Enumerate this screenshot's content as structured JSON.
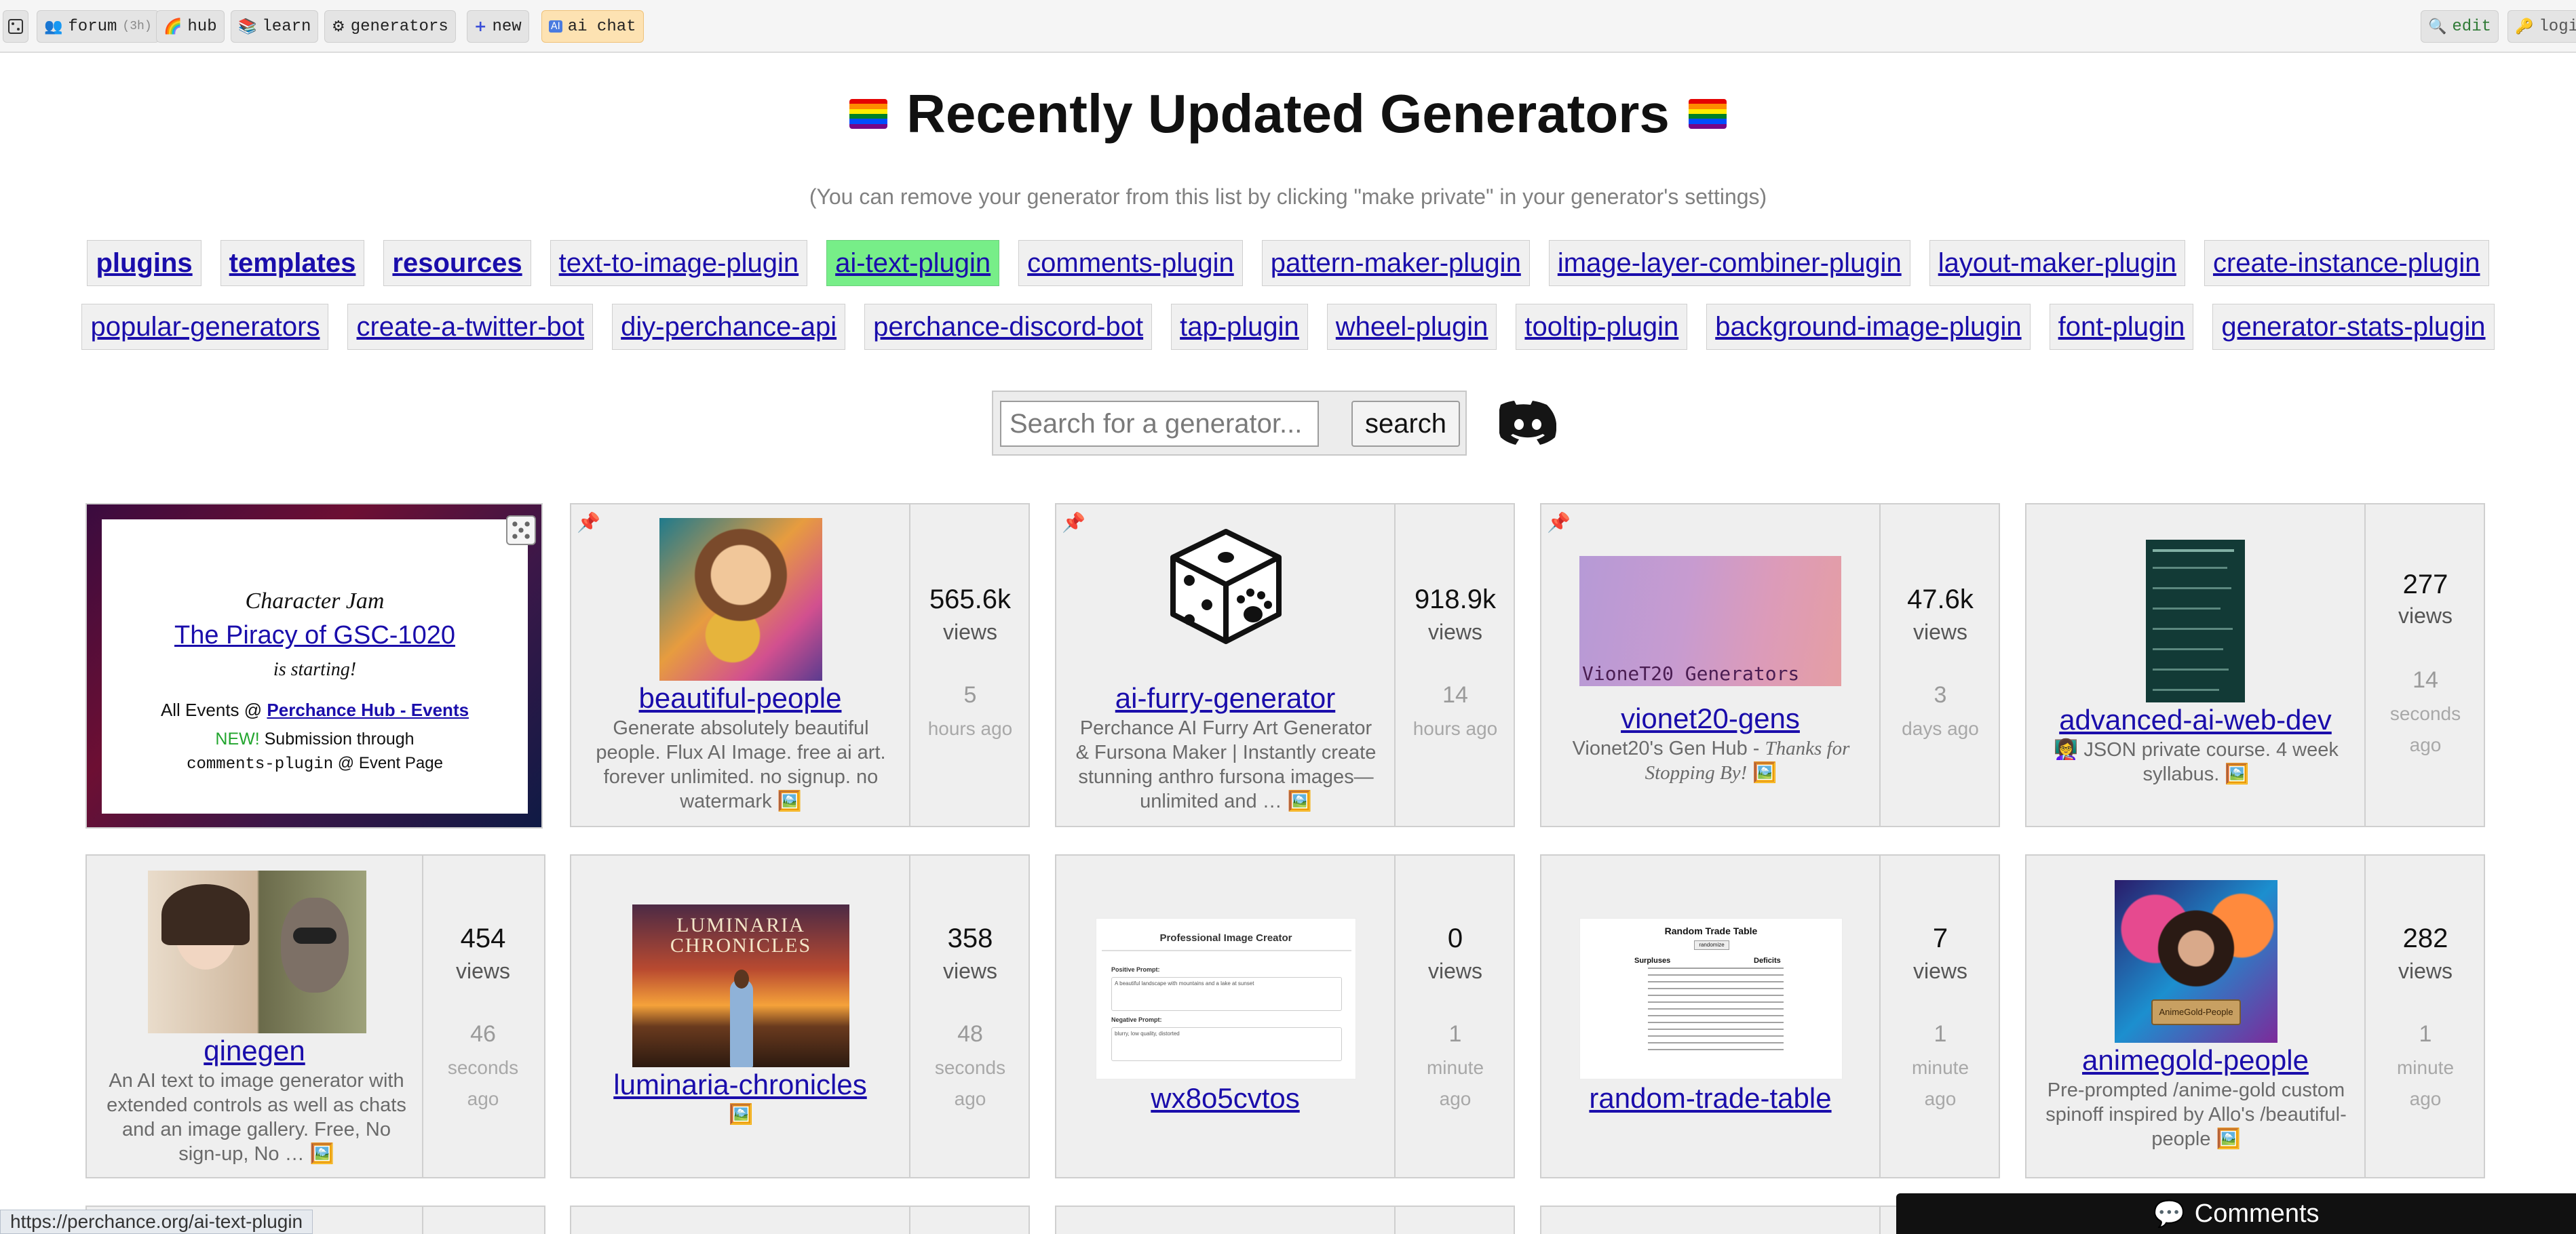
{
  "nav": {
    "items": [
      {
        "label": "forum",
        "suffix": "(3h)",
        "icon": "people-icon"
      },
      {
        "label": "hub",
        "icon": "rainbow-icon"
      },
      {
        "label": "learn",
        "icon": "books-icon"
      },
      {
        "label": "generators",
        "icon": "gears-icon"
      },
      {
        "label": "new",
        "icon": "plus-icon"
      },
      {
        "label": "ai chat",
        "icon": "robot-icon"
      }
    ],
    "edit": "edit",
    "login": "logi"
  },
  "header": {
    "title": "Recently Updated Generators",
    "subtitle": "(You can remove your generator from this list by clicking \"make private\" in your generator's settings)"
  },
  "tags_row1": [
    "plugins",
    "templates",
    "resources",
    "text-to-image-plugin",
    "ai-text-plugin",
    "comments-plugin",
    "pattern-maker-plugin",
    "image-layer-combiner-plugin",
    "layout-maker-plugin",
    "create-instance-plugin"
  ],
  "tags_row2": [
    "popular-generators",
    "create-a-twitter-bot",
    "diy-perchance-api",
    "perchance-discord-bot",
    "tap-plugin",
    "wheel-plugin",
    "tooltip-plugin",
    "background-image-plugin",
    "font-plugin",
    "generator-stats-plugin"
  ],
  "search": {
    "placeholder": "Search for a generator...",
    "button": "search"
  },
  "event": {
    "heading": "Character Jam",
    "link": "The Piracy of GSC-1020",
    "status": "is starting!",
    "events_prefix": "All Events @",
    "events_link": "Perchance Hub - Events",
    "new_label": "NEW!",
    "submission": "Submission through",
    "plugin": "comments-plugin",
    "plugin_suffix": "@ Event Page"
  },
  "cards": [
    {
      "name": "beautiful-people",
      "desc": "Generate absolutely beautiful people. Flux AI Image. free ai art. forever unlimited. no signup. no watermark",
      "views": "565.6k",
      "views_label": "views",
      "age_num": "5",
      "age_unit": "hours ago"
    },
    {
      "name": "ai-furry-generator",
      "desc": "Perchance AI Furry Art Generator & Fursona Maker | Instantly create stunning anthro fursona images—unlimited and …",
      "views": "918.9k",
      "views_label": "views",
      "age_num": "14",
      "age_unit": "hours ago"
    },
    {
      "name": "vionet20-gens",
      "desc_prefix": "Vionet20's Gen Hub -",
      "desc_italic": "Thanks for Stopping By!",
      "image_text": "VioneT20 Generators",
      "views": "47.6k",
      "views_label": "views",
      "age_num": "3",
      "age_unit": "days ago"
    },
    {
      "name": "advanced-ai-web-dev",
      "desc": "JSON private course. 4 week syllabus.",
      "views": "277",
      "views_label": "views",
      "age_num": "14",
      "age_unit": "seconds ago"
    },
    {
      "name": "qinegen",
      "desc": "An AI text to image generator with extended controls as well as chats and an image gallery. Free, No sign-up, No …",
      "views": "454",
      "views_label": "views",
      "age_num": "46",
      "age_unit": "seconds ago"
    },
    {
      "name": "luminaria-chronicles",
      "image_text": "LUMINARIA CHRONICLES",
      "views": "358",
      "views_label": "views",
      "age_num": "48",
      "age_unit": "seconds ago"
    },
    {
      "name": "wx8o5cvtos",
      "image_title": "Professional Image Creator",
      "image_field1": "Positive Prompt:",
      "image_value1": "A beautiful landscape with mountains and a lake at sunset",
      "image_field2": "Negative Prompt:",
      "image_value2": "blurry, low quality, distorted",
      "views": "0",
      "views_label": "views",
      "age_num": "1",
      "age_unit": "minute ago"
    },
    {
      "name": "random-trade-table",
      "image_title": "Random Trade Table",
      "image_button": "randomize",
      "image_col1": "Surpluses",
      "image_col2": "Deficits",
      "views": "7",
      "views_label": "views",
      "age_num": "1",
      "age_unit": "minute ago"
    },
    {
      "name": "animegold-people",
      "desc": "Pre-prompted /anime-gold custom spinoff inspired by Allo's /beautiful-people",
      "image_text": "AnimeGold-People",
      "views": "282",
      "views_label": "views",
      "age_num": "1",
      "age_unit": "minute ago"
    }
  ],
  "status_url": "https://perchance.org/ai-text-plugin",
  "comments": "Comments"
}
